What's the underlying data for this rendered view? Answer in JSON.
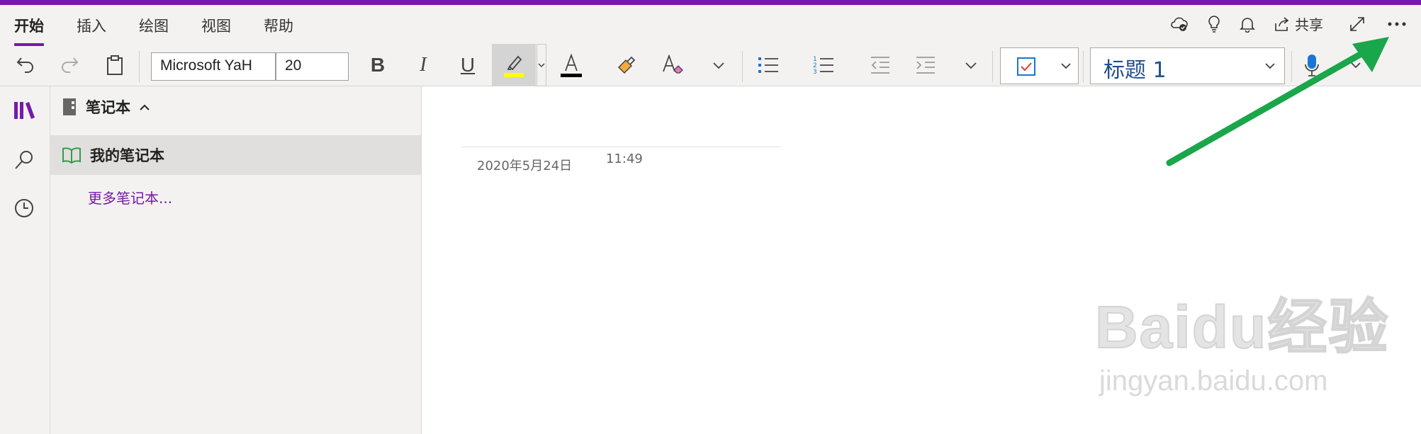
{
  "ribbon": {
    "tabs": [
      {
        "label": "开始",
        "active": true
      },
      {
        "label": "插入",
        "active": false
      },
      {
        "label": "绘图",
        "active": false
      },
      {
        "label": "视图",
        "active": false
      },
      {
        "label": "帮助",
        "active": false
      }
    ],
    "share_label": "共享",
    "font_name": "Microsoft YaH",
    "font_size": "20",
    "style_value": "标题 1",
    "highlight_color": "#ffff00",
    "font_color": "#000000",
    "accent_color": "#7719aa"
  },
  "nav": {
    "header_label": "笔记本",
    "notebook_label": "我的笔记本",
    "more_label": "更多笔记本..."
  },
  "page": {
    "date": "2020年5月24日",
    "time": "11:49"
  },
  "watermark": {
    "logo_text": "Baidu经验",
    "sub_text": "jingyan.baidu.com"
  }
}
